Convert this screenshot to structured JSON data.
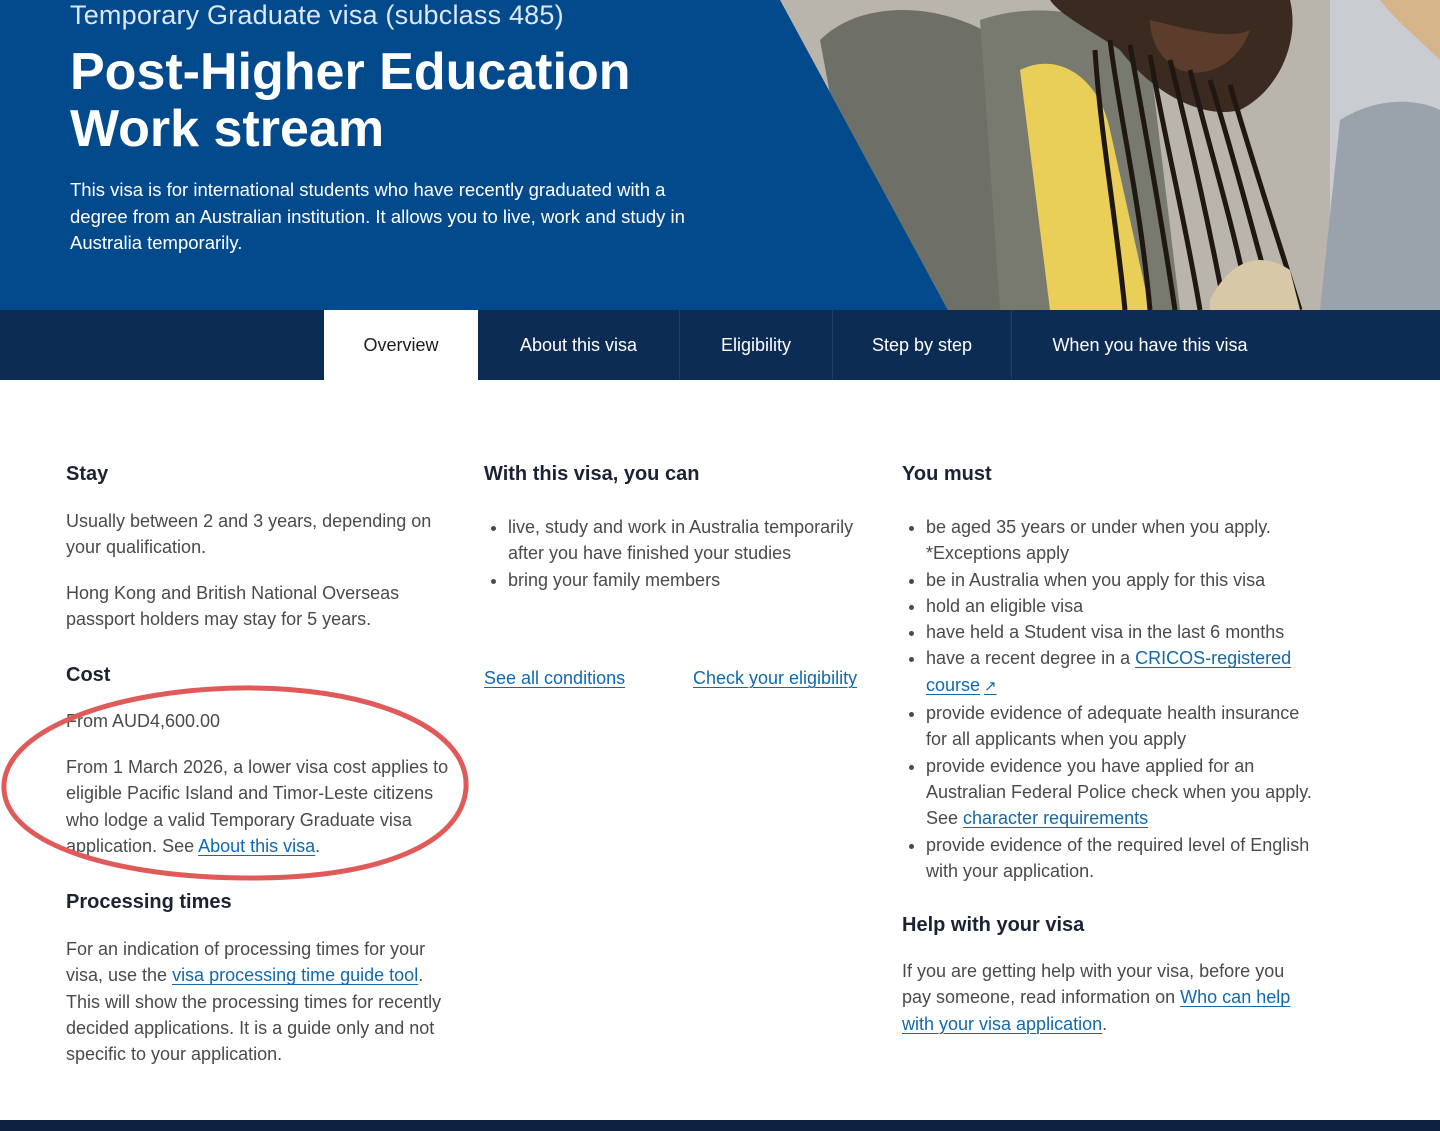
{
  "hero": {
    "subtitle": "Temporary Graduate visa (subclass 485)",
    "title_line1": "Post-Higher Education",
    "title_line2": "Work stream",
    "intro": "This visa is for international students who have recently graduated with a degree from an Australian institution. It allows you to live, work and study in Australia temporarily.",
    "background_color": "#034a8c"
  },
  "tabs": [
    {
      "label": "Overview",
      "active": true
    },
    {
      "label": "About this visa",
      "active": false
    },
    {
      "label": "Eligibility",
      "active": false
    },
    {
      "label": "Step by step",
      "active": false
    },
    {
      "label": "When you have this visa",
      "active": false
    }
  ],
  "left": {
    "stay_heading": "Stay",
    "stay_p1": "Usually between 2 and 3 years, depending on your qualification.",
    "stay_p2": "Hong Kong and British National Overseas passport holders may stay for 5 years.",
    "cost_heading": "Cost",
    "cost_value": "From AUD4,600.00",
    "cost_note_pre": "From 1 March 2026, a lower visa cost applies to eligible Pacific Island and Timor-Leste citizens who lodge a valid Temporary Graduate visa application. See ",
    "cost_note_link": "About this visa",
    "cost_note_post": ".",
    "processing_heading": "Processing times",
    "processing_pre": "For an indication of processing times for your visa, use the ",
    "processing_link": "visa processing time guide tool",
    "processing_post": ". This will show the processing times for recently decided applications. It is a guide only and not specific to your application."
  },
  "middle": {
    "heading": "With this visa, you can",
    "bullets": [
      "live, study and work in Australia temporarily after you have finished your studies",
      "bring your family members"
    ],
    "link_conditions": "See all conditions",
    "link_eligibility": "Check your eligibility"
  },
  "right": {
    "heading": "You must",
    "b1_line1": "be aged 35 years or under when you apply.",
    "b1_line2": "*Exceptions apply",
    "b2": "be in Australia when you apply for this visa",
    "b3": "hold an eligible visa",
    "b4": "have held a Student visa in the last 6 months",
    "b5_pre": "have a recent degree in a ",
    "b5_link": "CRICOS-registered course",
    "b5_icon": "external-link-icon",
    "b6": "provide evidence of adequate health insurance for all applicants when you apply",
    "b7_pre": "provide evidence you have applied for an Australian Federal Police check when you apply. See ",
    "b7_link": "character requirements",
    "b8": "provide evidence of the required level of English with your application.",
    "help_heading": "Help with your visa",
    "help_pre": "If you are getting help with your visa, before you pay someone, read information on ",
    "help_link": "Who can help with your visa application",
    "help_post": "."
  },
  "colors": {
    "tabbar": "#0d2c54",
    "link": "#1368ad",
    "annotation_circle": "#e05a5a"
  }
}
